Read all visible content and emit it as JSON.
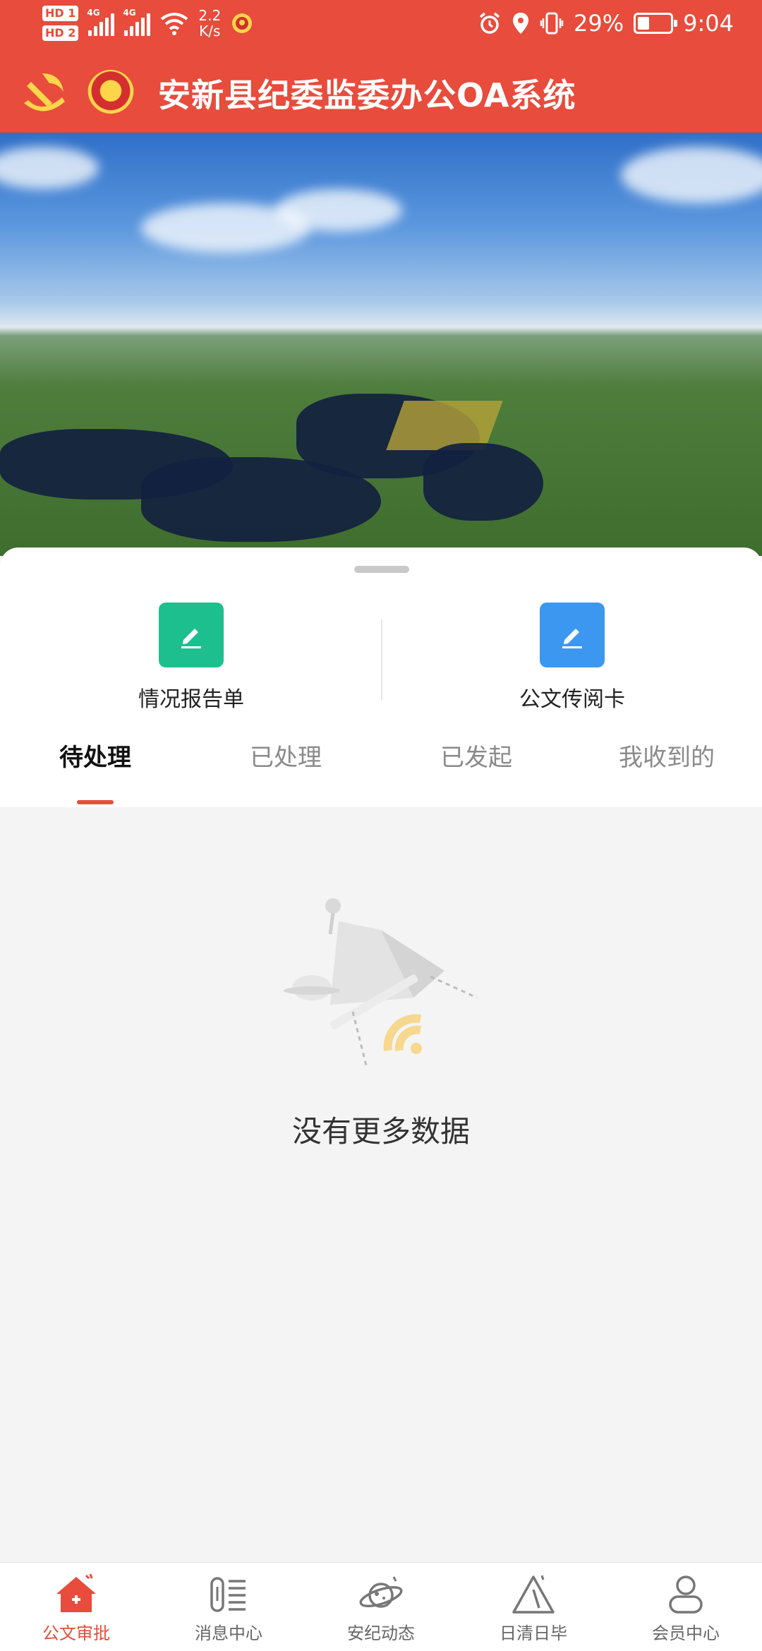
{
  "status_bar": {
    "sim1": "HD 1",
    "sim2": "HD 2",
    "net1": "4G",
    "net2": "4G",
    "speed_value": "2.2",
    "speed_unit": "K/s",
    "battery": "29%",
    "time": "9:04"
  },
  "header": {
    "title": "安新县纪委监委办公OA系统"
  },
  "quick_actions": [
    {
      "label": "情况报告单",
      "color": "#1dbf8f"
    },
    {
      "label": "公文传阅卡",
      "color": "#3b97f0"
    }
  ],
  "tabs": [
    "待处理",
    "已处理",
    "已发起",
    "我收到的"
  ],
  "active_tab": "待处理",
  "empty_state": {
    "message": "没有更多数据"
  },
  "bottom_nav": [
    {
      "label": "公文审批",
      "icon": "house-icon"
    },
    {
      "label": "消息中心",
      "icon": "message-list-icon"
    },
    {
      "label": "安纪动态",
      "icon": "planet-icon"
    },
    {
      "label": "日清日毕",
      "icon": "triangle-icon"
    },
    {
      "label": "会员中心",
      "icon": "user-icon"
    }
  ],
  "colors": {
    "brand_red": "#e74c3c",
    "green": "#1dbf8f",
    "blue": "#3b97f0"
  }
}
